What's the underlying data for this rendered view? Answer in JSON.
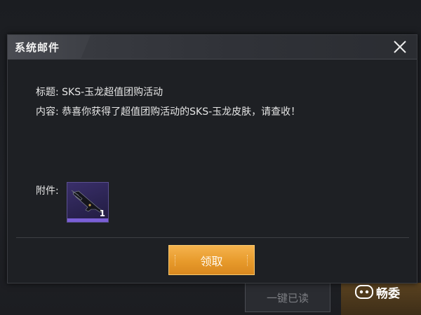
{
  "dialog": {
    "title": "系统邮件",
    "subject_row": "标题:  SKS-玉龙超值团购活动",
    "content_row": "内容:  恭喜你获得了超值团购活动的SKS-玉龙皮肤，请查收！",
    "attachment_label": "附件:",
    "attachment_item": {
      "icon": "rifle-icon",
      "count": "1"
    },
    "claim_label": "领取",
    "close_icon": "close-icon"
  },
  "background": {
    "read_all_label": "一键已读"
  },
  "watermark": {
    "text": "畅委"
  },
  "colors": {
    "accent_orange": "#e79a2b",
    "item_purple": "#7a5fd6",
    "panel": "#1e2024"
  }
}
